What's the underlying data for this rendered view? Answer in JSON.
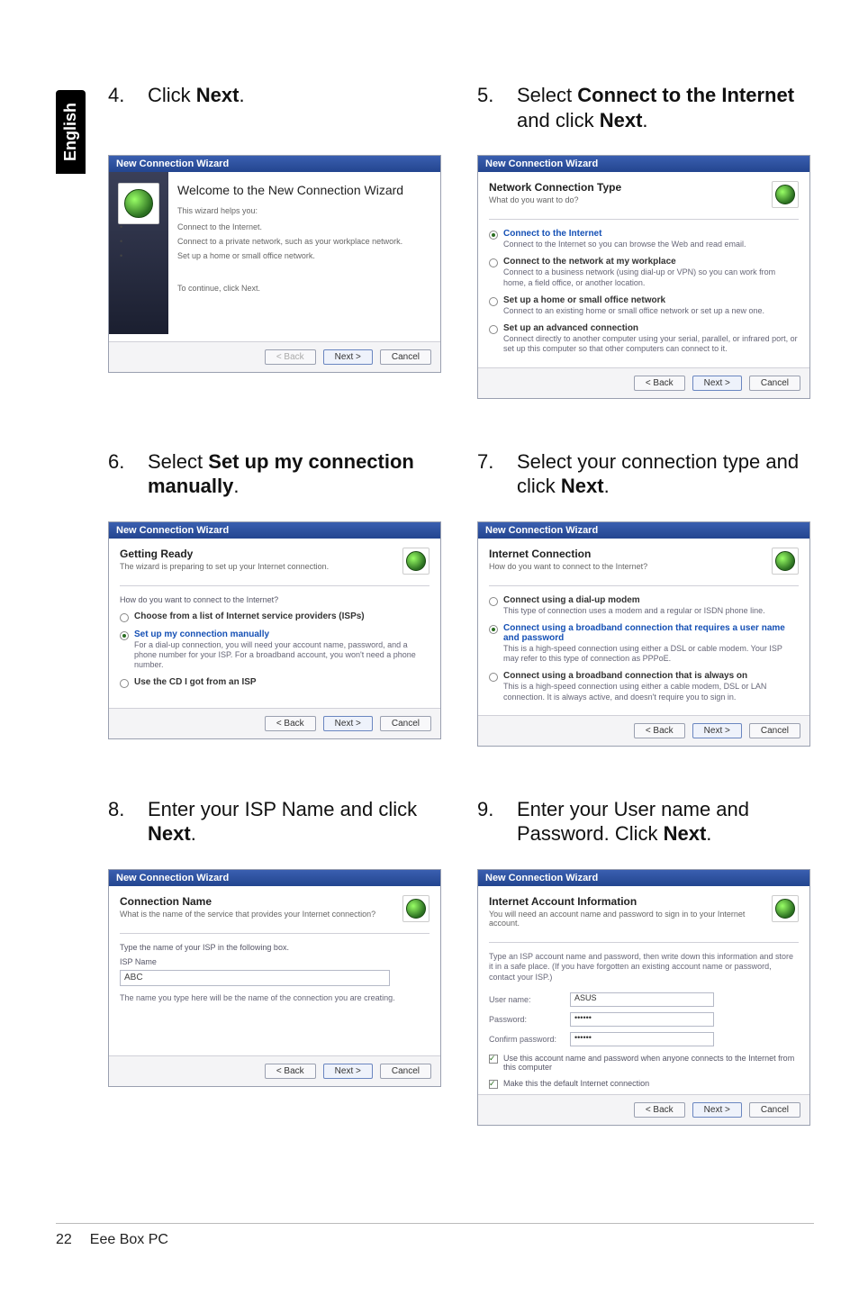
{
  "sideTab": "English",
  "steps": {
    "s4": {
      "num": "4.",
      "text_pre": "Click ",
      "bold": "Next",
      "text_post": "."
    },
    "s5": {
      "num": "5.",
      "text_pre": "Select ",
      "bold": "Connect to the Internet",
      "text_post": " and click ",
      "bold2": "Next",
      "tail": "."
    },
    "s6": {
      "num": "6.",
      "text_pre": "Select ",
      "bold": "Set up my connection manually",
      "text_post": "."
    },
    "s7": {
      "num": "7.",
      "text_pre": "Select your connection type and click ",
      "bold": "Next",
      "text_post": "."
    },
    "s8": {
      "num": "8.",
      "text_pre": "Enter your ISP Name and click ",
      "bold": "Next",
      "text_post": "."
    },
    "s9": {
      "num": "9.",
      "text_pre": "Enter your User name and Password. Click ",
      "bold": "Next",
      "text_post": "."
    }
  },
  "wizardTitle": "New Connection Wizard",
  "buttons": {
    "back": "< Back",
    "next": "Next >",
    "cancel": "Cancel"
  },
  "w4": {
    "heading": "Welcome to the New Connection Wizard",
    "lead": "This wizard helps you:",
    "bullets": [
      "Connect to the Internet.",
      "Connect to a private network, such as your workplace network.",
      "Set up a home or small office network."
    ],
    "continue": "To continue, click Next."
  },
  "w5": {
    "h": "Network Connection Type",
    "sub": "What do you want to do?",
    "opts": [
      {
        "label": "Connect to the Internet",
        "desc": "Connect to the Internet so you can browse the Web and read email.",
        "selected": true
      },
      {
        "label": "Connect to the network at my workplace",
        "desc": "Connect to a business network (using dial-up or VPN) so you can work from home, a field office, or another location."
      },
      {
        "label": "Set up a home or small office network",
        "desc": "Connect to an existing home or small office network or set up a new one."
      },
      {
        "label": "Set up an advanced connection",
        "desc": "Connect directly to another computer using your serial, parallel, or infrared port, or set up this computer so that other computers can connect to it."
      }
    ]
  },
  "w6": {
    "h": "Getting Ready",
    "sub": "The wizard is preparing to set up your Internet connection.",
    "question": "How do you want to connect to the Internet?",
    "opts": [
      {
        "label": "Choose from a list of Internet service providers (ISPs)"
      },
      {
        "label": "Set up my connection manually",
        "desc": "For a dial-up connection, you will need your account name, password, and a phone number for your ISP. For a broadband account, you won't need a phone number.",
        "selected": true
      },
      {
        "label": "Use the CD I got from an ISP"
      }
    ]
  },
  "w7": {
    "h": "Internet Connection",
    "sub": "How do you want to connect to the Internet?",
    "opts": [
      {
        "label": "Connect using a dial-up modem",
        "desc": "This type of connection uses a modem and a regular or ISDN phone line."
      },
      {
        "label": "Connect using a broadband connection that requires a user name and password",
        "desc": "This is a high-speed connection using either a DSL or cable modem. Your ISP may refer to this type of connection as PPPoE.",
        "selected": true
      },
      {
        "label": "Connect using a broadband connection that is always on",
        "desc": "This is a high-speed connection using either a cable modem, DSL or LAN connection. It is always active, and doesn't require you to sign in."
      }
    ]
  },
  "w8": {
    "h": "Connection Name",
    "sub": "What is the name of the service that provides your Internet connection?",
    "prompt": "Type the name of your ISP in the following box.",
    "fieldLabel": "ISP Name",
    "value": "ABC",
    "note": "The name you type here will be the name of the connection you are creating."
  },
  "w9": {
    "h": "Internet Account Information",
    "sub": "You will need an account name and password to sign in to your Internet account.",
    "lead": "Type an ISP account name and password, then write down this information and store it in a safe place. (If you have forgotten an existing account name or password, contact your ISP.)",
    "fields": {
      "userLabel": "User name:",
      "userValue": "ASUS",
      "passLabel": "Password:",
      "passValue": "••••••",
      "confirmLabel": "Confirm password:",
      "confirmValue": "••••••"
    },
    "checks": [
      "Use this account name and password when anyone connects to the Internet from this computer",
      "Make this the default Internet connection"
    ]
  },
  "footer": {
    "page": "22",
    "title": "Eee Box PC"
  }
}
